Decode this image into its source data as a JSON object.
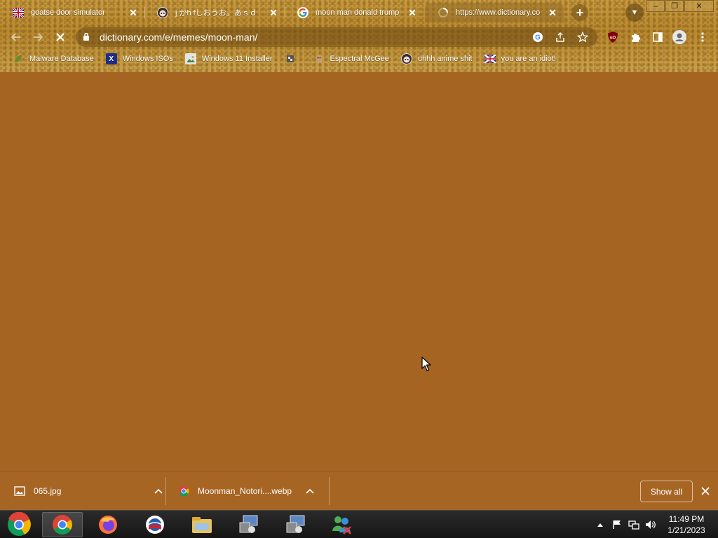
{
  "window": {
    "tabs": [
      {
        "title": "goatse door simulator",
        "favicon": "flag-favicon"
      },
      {
        "title": "j かh fしおうお。あｓｄ",
        "favicon": "anime-face-favicon"
      },
      {
        "title": "moon man donald trump - I",
        "favicon": "google-favicon"
      },
      {
        "title": "https://www.dictionary.co",
        "favicon": "loading-favicon"
      }
    ],
    "controls": {
      "minimize": "–",
      "restore": "❐",
      "close": "✕"
    }
  },
  "toolbar": {
    "url": "dictionary.com/e/memes/moon-man/",
    "loading": true
  },
  "bookmarks": [
    {
      "label": "Malware Database",
      "icon": "leaf-icon"
    },
    {
      "label": "Windows ISOs",
      "icon": "x-icon"
    },
    {
      "label": "Windows 11 Installer",
      "icon": "image-icon"
    },
    {
      "label": "",
      "icon": "pixel-icon"
    },
    {
      "label": "Espectral McGee",
      "icon": "face-icon"
    },
    {
      "label": "uhhh anime shit",
      "icon": "anime-face-icon"
    },
    {
      "label": "you are an idiot!",
      "icon": "flag-icon"
    }
  ],
  "downloads": {
    "items": [
      {
        "name": "065.jpg",
        "icon": "image-file-icon"
      },
      {
        "name": "Moonman_Notori....webp",
        "icon": "chrome-icon"
      }
    ],
    "show_all": "Show all"
  },
  "taskbar": {
    "apps": [
      "chrome-start-orb",
      "chrome",
      "firefox",
      "internet-explorer-old",
      "file-explorer",
      "network-utility",
      "network-utility-2",
      "messenger"
    ],
    "clock_time": "11:49 PM",
    "clock_date": "1/21/2023"
  },
  "colors": {
    "page_background": "#a56422",
    "chrome_background": "#c69a3f",
    "taskbar": "#1e1e1e"
  }
}
